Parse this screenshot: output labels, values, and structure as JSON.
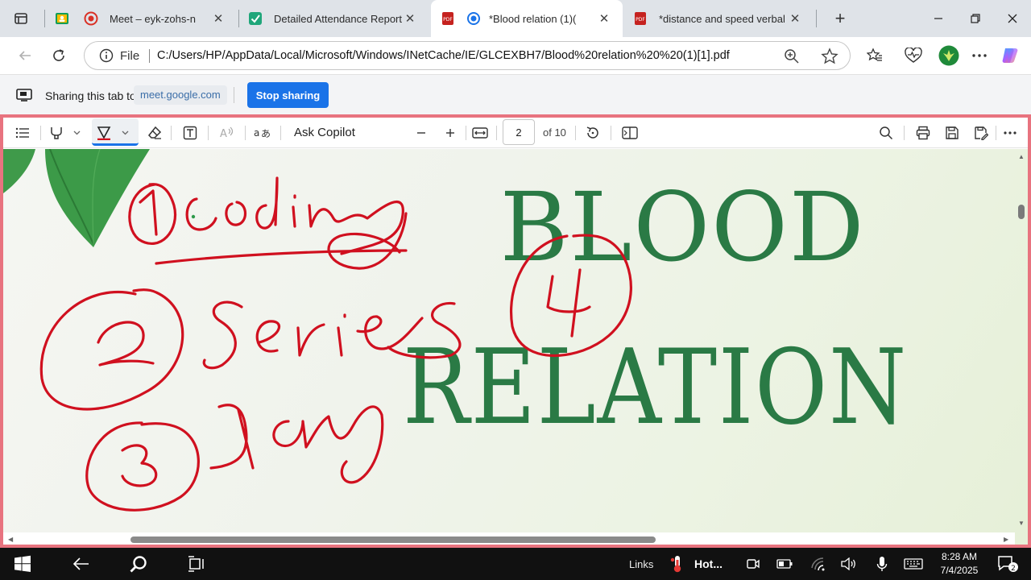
{
  "tabs": [
    {
      "title": "Meet – eyk-zohs-n",
      "favicon": "meet-record-icon"
    },
    {
      "title": "Detailed Attendance Report",
      "favicon": "attendance-check-icon"
    },
    {
      "title": "*Blood relation (1)(",
      "favicon": "pdf-icon",
      "active": true
    },
    {
      "title": "*distance and speed verbal",
      "favicon": "pdf-icon"
    }
  ],
  "address": {
    "scheme_label": "File",
    "url": "C:/Users/HP/AppData/Local/Microsoft/Windows/INetCache/IE/GLCEXBH7/Blood%20relation%20%20(1)[1].pdf"
  },
  "sharing": {
    "text": "Sharing this tab to",
    "host": "meet.google.com",
    "stop_label": "Stop sharing"
  },
  "pdf_toolbar": {
    "ask_copilot": "Ask Copilot",
    "page_number": "2",
    "page_total": "of 10"
  },
  "document": {
    "headline_line1": "BLOOD",
    "headline_line2": "RELATION",
    "accent_color": "#2a7a45",
    "ink_color": "#d0101f"
  },
  "taskbar": {
    "links_label": "Links",
    "weather_label": "Hot...",
    "time": "8:28 AM",
    "date": "7/4/2025",
    "notification_count": "2"
  }
}
